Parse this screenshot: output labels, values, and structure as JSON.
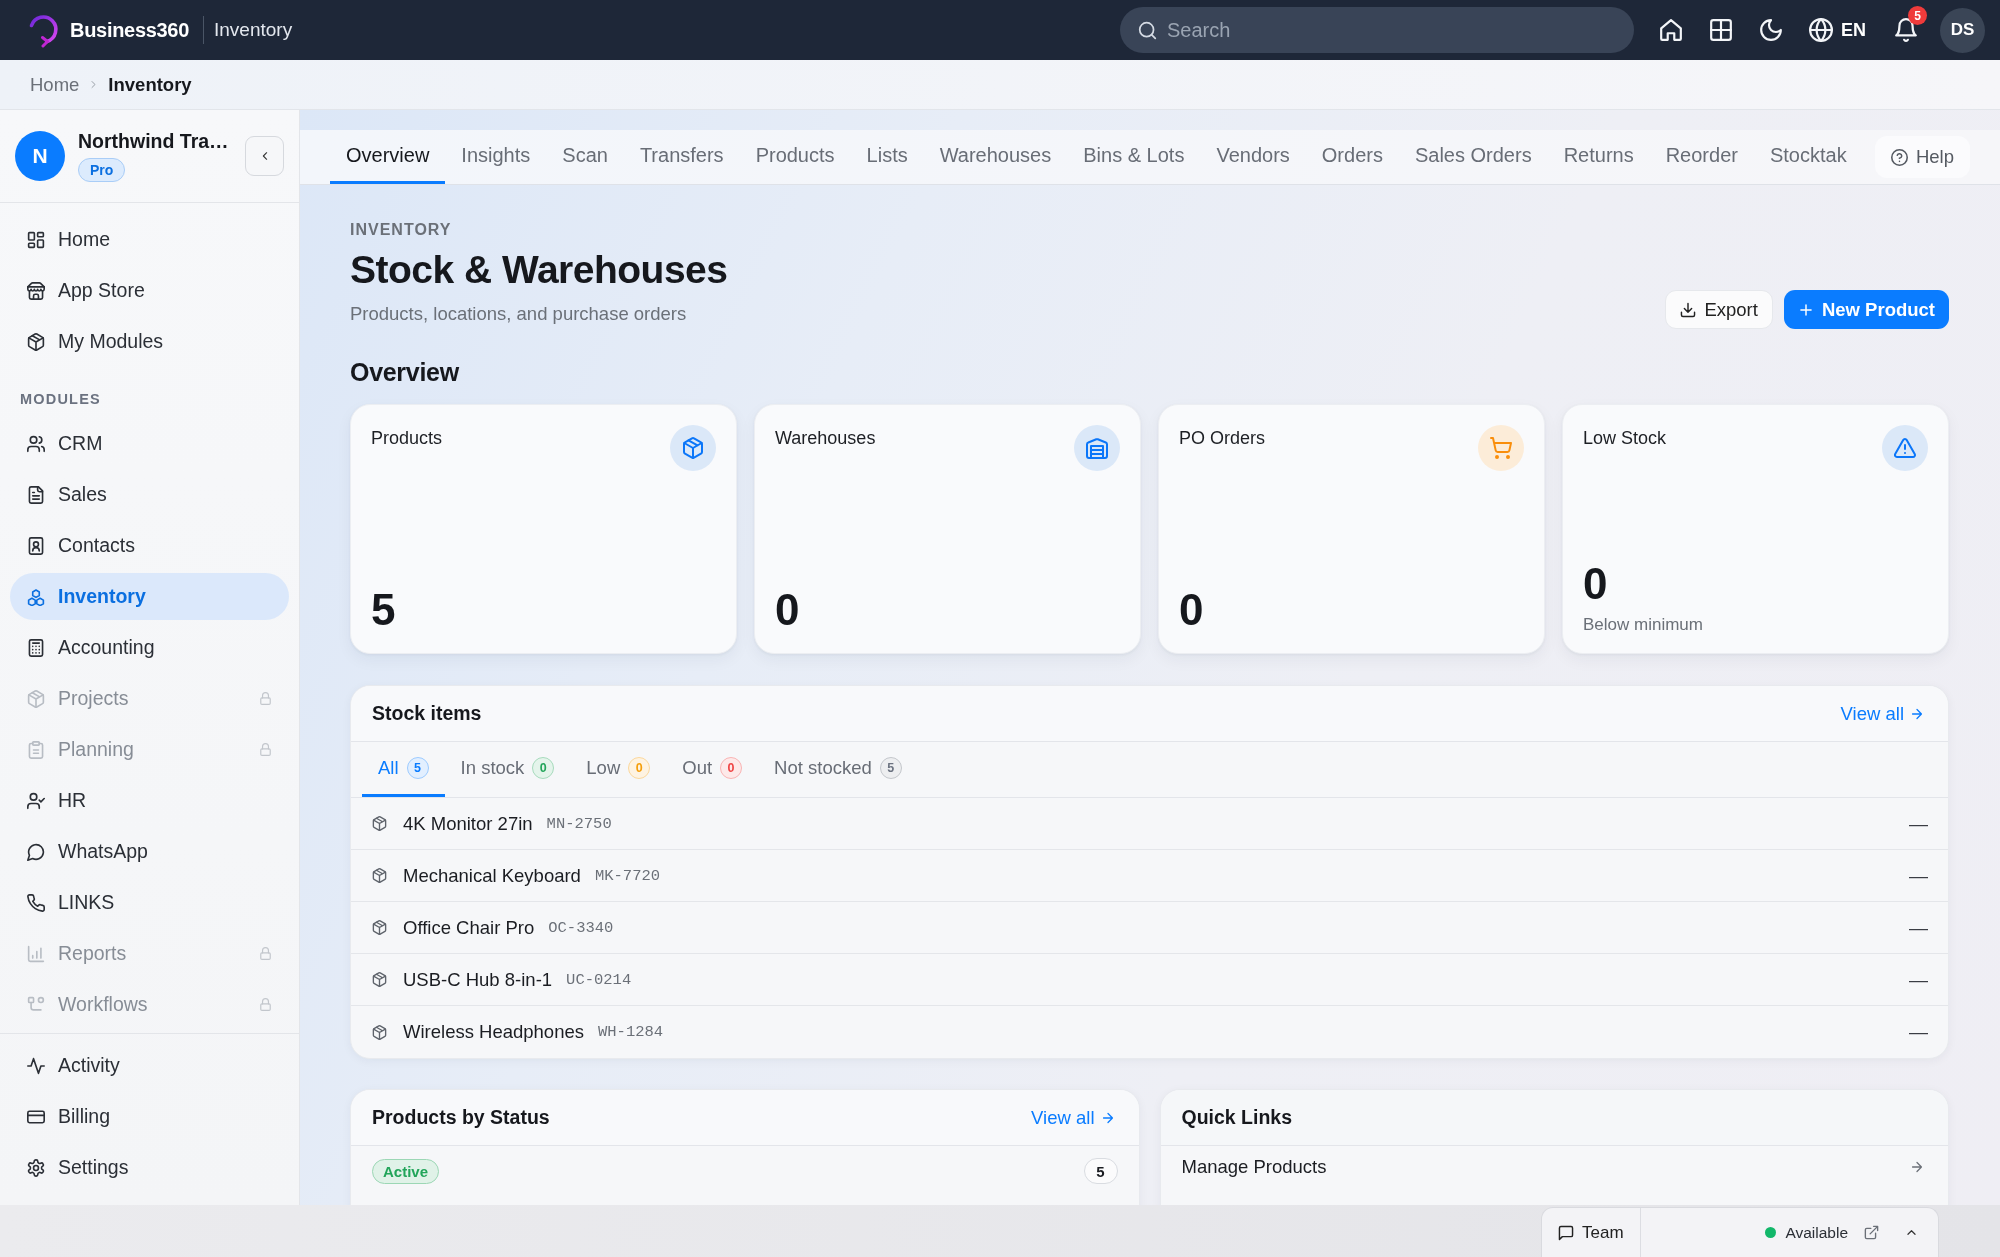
{
  "topbar": {
    "brand": "Business360",
    "section": "Inventory",
    "search": {
      "placeholder": "Search"
    },
    "language": "EN",
    "notification_count": "5",
    "avatar": "DS"
  },
  "breadcrumb": [
    {
      "label": "Home",
      "current": false
    },
    {
      "label": "Inventory",
      "current": true
    }
  ],
  "sidebar": {
    "org": {
      "initial": "N",
      "name": "Northwind Tra…",
      "plan": "Pro"
    },
    "items": [
      {
        "label": "Home",
        "selected": false
      },
      {
        "label": "App Store",
        "selected": false
      },
      {
        "label": "My Modules",
        "selected": false
      }
    ],
    "modules": {
      "heading": "MODULES",
      "items": [
        {
          "label": "CRM",
          "selected": false,
          "locked": false
        },
        {
          "label": "Sales",
          "selected": false,
          "locked": false
        },
        {
          "label": "Contacts",
          "selected": false,
          "locked": false
        },
        {
          "label": "Inventory",
          "selected": true,
          "locked": false
        },
        {
          "label": "Accounting",
          "selected": false,
          "locked": false
        },
        {
          "label": "Projects",
          "selected": false,
          "locked": true
        },
        {
          "label": "Planning",
          "selected": false,
          "locked": true
        },
        {
          "label": "HR",
          "selected": false,
          "locked": false
        },
        {
          "label": "WhatsApp",
          "selected": false,
          "locked": false
        },
        {
          "label": "LINKS",
          "selected": false,
          "locked": false
        },
        {
          "label": "Reports",
          "selected": false,
          "locked": true
        },
        {
          "label": "Workflows",
          "selected": false,
          "locked": true
        }
      ]
    },
    "footer_items": [
      {
        "label": "Activity",
        "selected": false
      },
      {
        "label": "Billing",
        "selected": false
      },
      {
        "label": "Settings",
        "selected": false
      }
    ]
  },
  "tabs": [
    {
      "label": "Overview",
      "selected": true
    },
    {
      "label": "Insights",
      "selected": false
    },
    {
      "label": "Scan",
      "selected": false
    },
    {
      "label": "Transfers",
      "selected": false
    },
    {
      "label": "Products",
      "selected": false
    },
    {
      "label": "Lists",
      "selected": false
    },
    {
      "label": "Warehouses",
      "selected": false
    },
    {
      "label": "Bins & Lots",
      "selected": false
    },
    {
      "label": "Vendors",
      "selected": false
    },
    {
      "label": "Orders",
      "selected": false
    },
    {
      "label": "Sales Orders",
      "selected": false
    },
    {
      "label": "Returns",
      "selected": false
    },
    {
      "label": "Reorder",
      "selected": false
    },
    {
      "label": "Stocktak",
      "selected": false
    }
  ],
  "help_button": "Help",
  "header": {
    "eyebrow": "INVENTORY",
    "title": "Stock & Warehouses",
    "subtitle": "Products, locations, and purchase orders",
    "actions": [
      {
        "label": "Export",
        "kind": "secondary"
      },
      {
        "label": "New Product",
        "kind": "primary"
      }
    ]
  },
  "overview": {
    "heading": "Overview",
    "cards": [
      {
        "title": "Products",
        "value": "5",
        "color": "#dbe8f8"
      },
      {
        "title": "Warehouses",
        "value": "0",
        "color": "#dbe8f8"
      },
      {
        "title": "PO Orders",
        "value": "0",
        "color": "#fcecd8"
      },
      {
        "title": "Low Stock",
        "value": "0",
        "note": "Below minimum",
        "color": "#dbe8f8"
      }
    ]
  },
  "stock_items": {
    "title": "Stock items",
    "view_all": "View all",
    "filters": [
      {
        "label": "All",
        "count": "5",
        "selected": true,
        "color": "#0a7cff"
      },
      {
        "label": "In stock",
        "count": "0",
        "selected": false,
        "color": "#22a55a"
      },
      {
        "label": "Low",
        "count": "0",
        "selected": false,
        "color": "#f59e0b"
      },
      {
        "label": "Out",
        "count": "0",
        "selected": false,
        "color": "#ef4444"
      },
      {
        "label": "Not stocked",
        "count": "5",
        "selected": false,
        "color": "#6b7280"
      }
    ],
    "rows": [
      {
        "name": "4K Monitor 27in",
        "sku": "MN-2750",
        "quantity": "—"
      },
      {
        "name": "Mechanical Keyboard",
        "sku": "MK-7720",
        "quantity": "—"
      },
      {
        "name": "Office Chair Pro",
        "sku": "OC-3340",
        "quantity": "—"
      },
      {
        "name": "USB-C Hub 8-in-1",
        "sku": "UC-0214",
        "quantity": "—"
      },
      {
        "name": "Wireless Headphones",
        "sku": "WH-1284",
        "quantity": "—"
      }
    ]
  },
  "products_by_status": {
    "title": "Products by Status",
    "view_all": "View all",
    "rows": [
      {
        "status": "Active",
        "count": "5",
        "color": "#22a55a"
      }
    ]
  },
  "quick_links": {
    "title": "Quick Links",
    "links": [
      "Manage Products"
    ]
  },
  "team_widget": {
    "label": "Team",
    "status": "Available",
    "online": true
  }
}
